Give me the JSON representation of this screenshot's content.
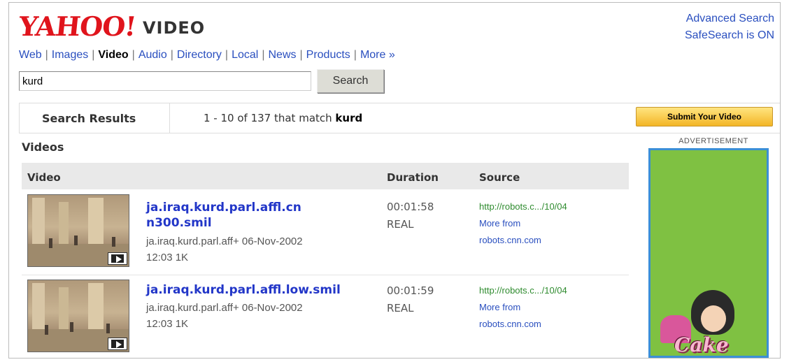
{
  "header": {
    "logo_text": "YAHOO!",
    "logo_sub": "VIDEO",
    "advanced_search": "Advanced Search",
    "safesearch": "SafeSearch is ON"
  },
  "nav": {
    "items": [
      "Web",
      "Images",
      "Video",
      "Audio",
      "Directory",
      "Local",
      "News",
      "Products",
      "More »"
    ],
    "current": "Video"
  },
  "search": {
    "value": "kurd",
    "button_label": "Search"
  },
  "results_bar": {
    "label": "Search Results",
    "count_prefix": "1 - 10 of 137 that match",
    "query": "kurd",
    "submit_label": "Submit Your Video"
  },
  "videos": {
    "section_title": "Videos",
    "columns": {
      "video": "Video",
      "duration": "Duration",
      "source": "Source"
    },
    "rows": [
      {
        "title_line1": "ja.iraq.kurd.parl.affl.cn",
        "title_line2": "n300.smil",
        "meta_line1": "ja.iraq.kurd.parl.aff+ 06-Nov-2002",
        "meta_line2": "12:03 1K",
        "duration": "00:01:58",
        "format": "REAL",
        "source_url": "http://robots.c.../10/04",
        "more_from": "More from",
        "domain": "robots.cnn.com"
      },
      {
        "title_line1": "ja.iraq.kurd.parl.affl.low.smil",
        "meta_line1": "ja.iraq.kurd.parl.aff+ 06-Nov-2002",
        "meta_line2": "12:03 1K",
        "duration": "00:01:59",
        "format": "REAL",
        "source_url": "http://robots.c.../10/04",
        "more_from": "More from",
        "domain": "robots.cnn.com"
      }
    ]
  },
  "advertisement": {
    "label": "ADVERTISEMENT",
    "ad_text": "Cake"
  },
  "colors": {
    "yahoo_red": "#e0141c",
    "link_blue": "#2a4fbf",
    "title_blue": "#2236c8",
    "url_green": "#2e8b2e",
    "ad_green": "#7fc142",
    "ad_border": "#3b8fd6"
  }
}
